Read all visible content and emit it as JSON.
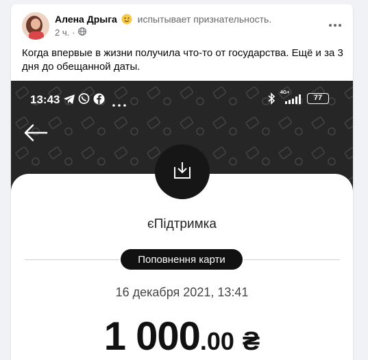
{
  "post": {
    "author": "Алена Дрыга",
    "feeling_text": "испытывает признательность.",
    "time": "2 ч.",
    "text": "Когда впервые в жизни получила что-то от государства. Ещё и за 3 дня до обещанной даты."
  },
  "phone": {
    "status_time": "13:43",
    "battery": "77",
    "network_label": "4G+",
    "service_name": "єПідтримка",
    "badge": "Поповнення карти",
    "date": "16 декабря 2021, 13:41",
    "amount_int": "1 000",
    "amount_frac": ".00",
    "currency": "₴"
  },
  "icons": {
    "privacy": "globe-icon",
    "feeling": "smiley-icon",
    "more": "more-icon",
    "back": "arrow-left-icon",
    "download": "download-icon"
  }
}
